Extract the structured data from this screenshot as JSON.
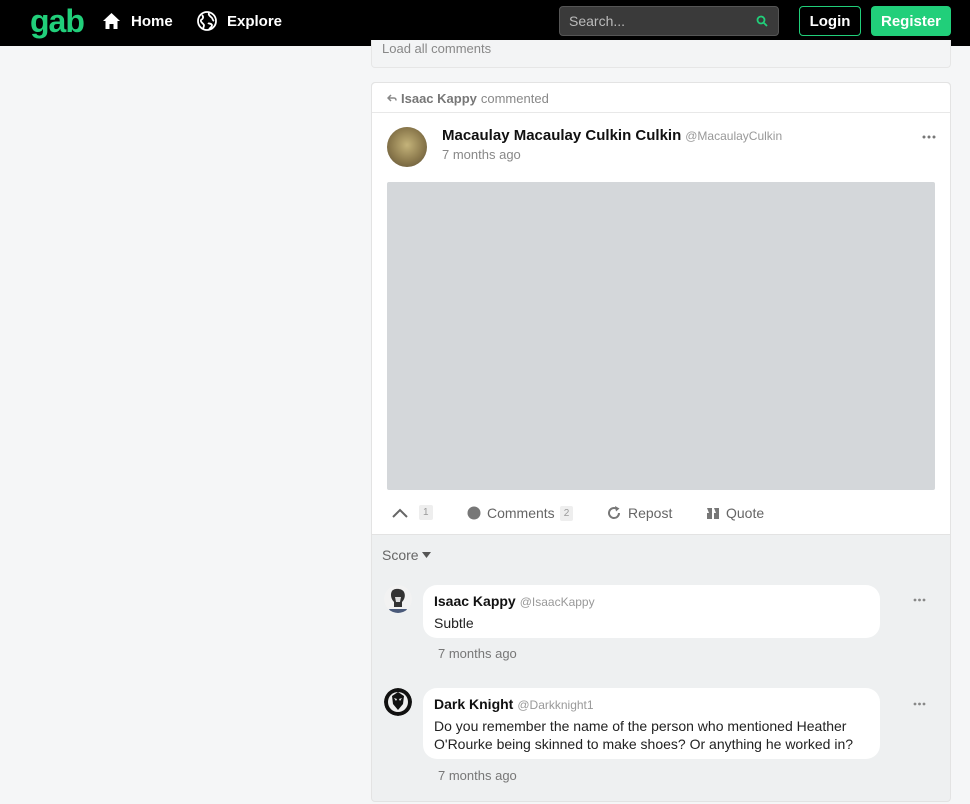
{
  "header": {
    "logo": "gab",
    "nav": [
      {
        "label": "Home",
        "icon": "home-icon"
      },
      {
        "label": "Explore",
        "icon": "globe-icon"
      }
    ],
    "search_placeholder": "Search...",
    "login_label": "Login",
    "register_label": "Register"
  },
  "previous": {
    "load_comments": "Load all comments"
  },
  "post": {
    "commenter": "Isaac Kappy",
    "commented_label": "commented",
    "author_name": "Macaulay Macaulay Culkin Culkin",
    "author_handle": "@MacaulayCulkin",
    "time": "7 months ago",
    "actions": {
      "like_count": "1",
      "comments_label": "Comments",
      "comments_count": "2",
      "repost_label": "Repost",
      "quote_label": "Quote"
    }
  },
  "comments_section": {
    "sort_label": "Score",
    "comments": [
      {
        "name": "Isaac Kappy",
        "handle": "@IsaacKappy",
        "text": "Subtle",
        "time": "7 months ago"
      },
      {
        "name": "Dark Knight",
        "handle": "@Darkknight1",
        "text_line1": "Do you remember the name of the person who mentioned Heather",
        "text_line2": "O'Rourke being skinned to make shoes? Or anything he worked in?",
        "time": "7 months ago"
      }
    ]
  },
  "colors": {
    "brand": "#21cf7a",
    "topbar": "#000000"
  }
}
